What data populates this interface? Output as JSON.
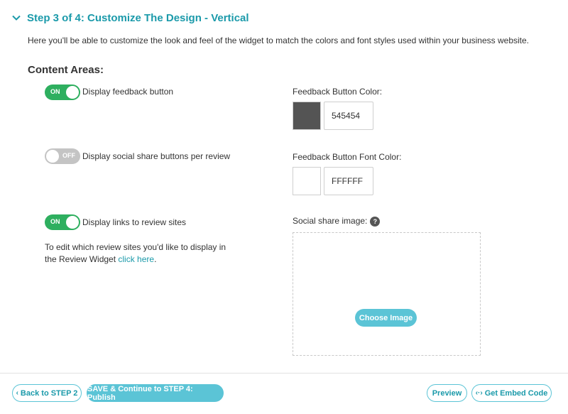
{
  "step": {
    "title": "Step 3 of 4: Customize The Design - Vertical",
    "intro": "Here you'll be able to customize the look and feel of the widget to match the colors and font styles used within your business website."
  },
  "content_areas": {
    "title": "Content Areas:",
    "options": [
      {
        "toggle": "ON",
        "state": true,
        "label": "Display feedback button"
      },
      {
        "toggle": "OFF",
        "state": false,
        "label": "Display social share buttons per review"
      },
      {
        "toggle": "ON",
        "state": true,
        "label": "Display links to review sites"
      }
    ],
    "edit_text": "To edit which review sites you'd like to display in the Review Widget",
    "edit_link": "click here",
    "edit_suffix": "."
  },
  "colors": {
    "feedback_button_label": "Feedback Button Color:",
    "feedback_button_value": "545454",
    "feedback_button_swatch": "#545454",
    "font_color_label": "Feedback Button Font Color:",
    "font_color_value": "FFFFFF",
    "font_color_swatch": "#FFFFFF"
  },
  "social_image": {
    "label": "Social share image:",
    "help": "?",
    "button": "Choose Image"
  },
  "footer": {
    "back": "Back to STEP 2",
    "save": "SAVE & Continue to STEP 4: Publish",
    "preview": "Preview",
    "embed": "Get Embed Code"
  },
  "theme": {
    "accent": "#1b9aaa",
    "button": "#5bc4d6",
    "toggle_on": "#2eaf5f",
    "toggle_off": "#c4c4c4"
  }
}
